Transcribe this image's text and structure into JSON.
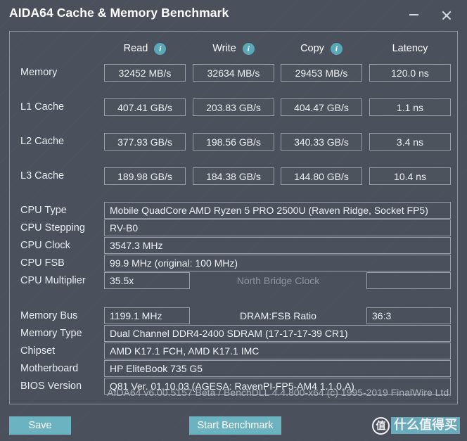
{
  "window": {
    "title": "AIDA64 Cache & Memory Benchmark",
    "minimize_label": "–",
    "close_label": "×",
    "minimize_icon": "minimize-icon",
    "close_icon": "close-icon"
  },
  "theme": {
    "background": "#4a515c",
    "accent": "#6cb3c2",
    "info_icon": "#59a8b8",
    "border": "#99a0a8",
    "text": "#eef1f3",
    "dim_text": "#8e959d"
  },
  "benchmark": {
    "columns": [
      {
        "label": "Read",
        "has_info": true,
        "info_icon": "info-icon"
      },
      {
        "label": "Write",
        "has_info": true,
        "info_icon": "info-icon"
      },
      {
        "label": "Copy",
        "has_info": true,
        "info_icon": "info-icon"
      },
      {
        "label": "Latency",
        "has_info": false,
        "info_icon": ""
      }
    ],
    "rows": [
      {
        "label": "Memory",
        "values": [
          "32452 MB/s",
          "32634 MB/s",
          "29453 MB/s",
          "120.0 ns"
        ]
      },
      {
        "label": "L1 Cache",
        "values": [
          "407.41 GB/s",
          "203.83 GB/s",
          "404.47 GB/s",
          "1.1 ns"
        ]
      },
      {
        "label": "L2 Cache",
        "values": [
          "377.93 GB/s",
          "198.56 GB/s",
          "340.33 GB/s",
          "3.4 ns"
        ]
      },
      {
        "label": "L3 Cache",
        "values": [
          "189.98 GB/s",
          "184.38 GB/s",
          "144.80 GB/s",
          "10.4 ns"
        ]
      }
    ]
  },
  "cpu_info": {
    "type_label": "CPU Type",
    "type_value": "Mobile QuadCore AMD Ryzen 5 PRO 2500U  (Raven Ridge, Socket FP5)",
    "stepping_label": "CPU Stepping",
    "stepping_value": "RV-B0",
    "clock_label": "CPU Clock",
    "clock_value": "3547.3 MHz",
    "fsb_label": "CPU FSB",
    "fsb_value": "99.9 MHz  (original: 100 MHz)",
    "multiplier_label": "CPU Multiplier",
    "multiplier_value": "35.5x",
    "north_bridge_label": "North Bridge Clock",
    "north_bridge_value": ""
  },
  "memory_info": {
    "bus_label": "Memory Bus",
    "bus_value": "1199.1 MHz",
    "dram_ratio_label": "DRAM:FSB Ratio",
    "dram_ratio_value": "36:3",
    "type_label": "Memory Type",
    "type_value": "Dual Channel DDR4-2400 SDRAM  (17-17-17-39 CR1)",
    "chipset_label": "Chipset",
    "chipset_value": "AMD K17.1 FCH, AMD K17.1 IMC",
    "motherboard_label": "Motherboard",
    "motherboard_value": "HP EliteBook 735 G5",
    "bios_label": "BIOS Version",
    "bios_value": "Q81 Ver. 01.10.03  (AGESA: RavenPI-FP5-AM4 1.1.0.A)"
  },
  "footer": {
    "version_text": "AIDA64 v6.00.5157 Beta / BenchDLL 4.4.800-x64  (c) 1995-2019 FinalWire Ltd.",
    "save_label": "Save",
    "start_label": "Start Benchmark"
  },
  "watermark": {
    "badge": "值",
    "text": "什么值得买"
  }
}
